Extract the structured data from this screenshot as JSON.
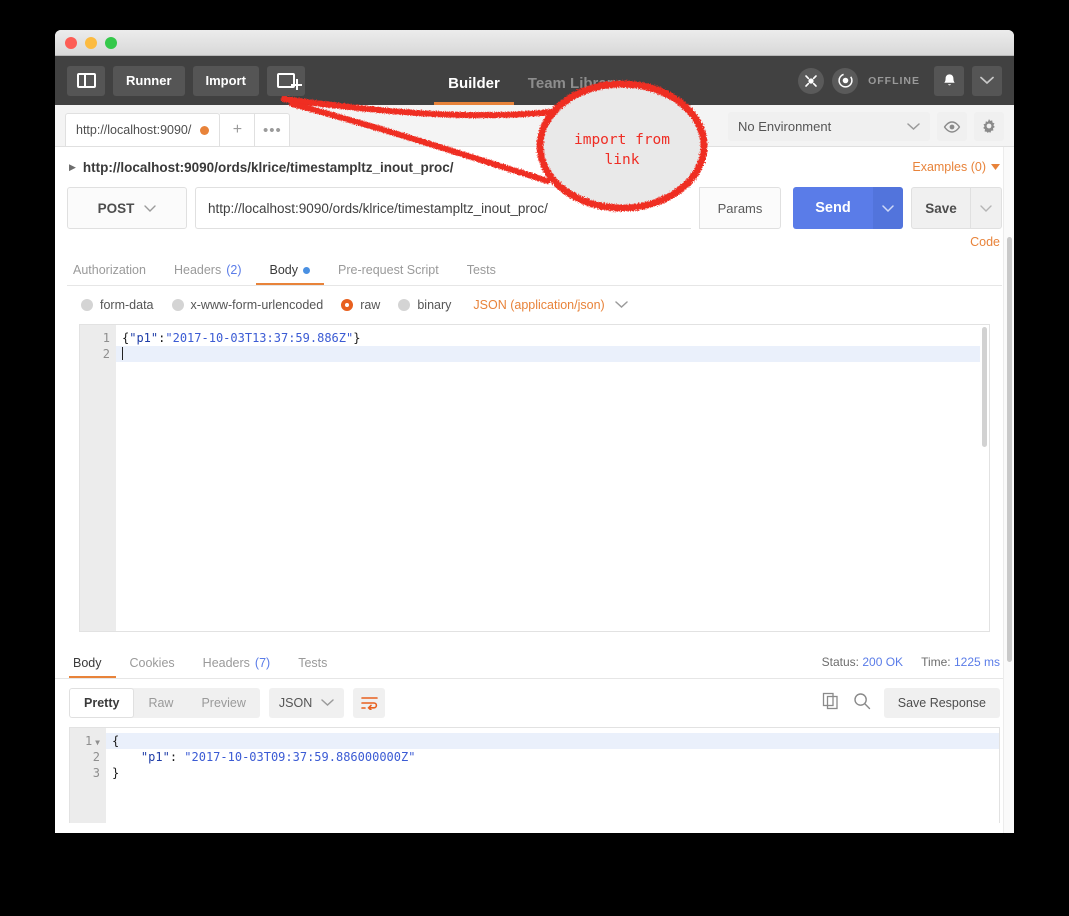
{
  "window": {
    "traffic_lights": [
      "close",
      "minimize",
      "zoom"
    ]
  },
  "toolbar": {
    "sidebar_toggle_icon": "sidebar-toggle-icon",
    "runner_label": "Runner",
    "import_label": "Import",
    "new_tab_icon": "new-tab-plus-icon",
    "tabs": [
      {
        "label": "Builder",
        "active": true
      },
      {
        "label": "Team Library",
        "active": false
      }
    ],
    "interceptor_icon": "interceptor-icon",
    "sync_icon": "sync-icon",
    "sync_status": "OFFLINE",
    "bell_icon": "bell-icon",
    "account_chevron_icon": "chevron-down-icon"
  },
  "tabstrip": {
    "request_tab_label": "http://localhost:9090/",
    "unsaved_indicator": "unsaved-dot",
    "new_tab_label": "+",
    "more_label": "•••",
    "environment_value": "No Environment",
    "eye_icon": "eye-icon",
    "gear_icon": "gear-icon"
  },
  "request": {
    "breadcrumb": "http://localhost:9090/ords/klrice/timestampltz_inout_proc/",
    "examples_label": "Examples (0)",
    "method": "POST",
    "url": "http://localhost:9090/ords/klrice/timestampltz_inout_proc/",
    "params_label": "Params",
    "send_label": "Send",
    "save_label": "Save",
    "code_label": "Code",
    "tabs": [
      {
        "label": "Authorization",
        "count": "",
        "active": false,
        "dot": false
      },
      {
        "label": "Headers",
        "count": "(2)",
        "active": false,
        "dot": false
      },
      {
        "label": "Body",
        "count": "",
        "active": true,
        "dot": true
      },
      {
        "label": "Pre-request Script",
        "count": "",
        "active": false,
        "dot": false
      },
      {
        "label": "Tests",
        "count": "",
        "active": false,
        "dot": false
      }
    ],
    "body_types": [
      {
        "label": "form-data",
        "selected": false
      },
      {
        "label": "x-www-form-urlencoded",
        "selected": false
      },
      {
        "label": "raw",
        "selected": true
      },
      {
        "label": "binary",
        "selected": false
      }
    ],
    "body_format": "JSON (application/json)",
    "body_lines": [
      "1",
      "2"
    ],
    "body_code": {
      "line1_open": "{",
      "line1_key": "\"p1\"",
      "line1_colon": ":",
      "line1_value": "\"2017-10-03T13:37:59.886Z\"",
      "line1_close": "}"
    }
  },
  "response": {
    "tabs": [
      {
        "label": "Body",
        "count": "",
        "active": true
      },
      {
        "label": "Cookies",
        "count": "",
        "active": false
      },
      {
        "label": "Headers",
        "count": "(7)",
        "active": false
      },
      {
        "label": "Tests",
        "count": "",
        "active": false
      }
    ],
    "status_label": "Status:",
    "status_value": "200 OK",
    "time_label": "Time:",
    "time_value": "1225 ms",
    "view_modes": [
      {
        "label": "Pretty",
        "active": true
      },
      {
        "label": "Raw",
        "active": false
      },
      {
        "label": "Preview",
        "active": false
      }
    ],
    "format": "JSON",
    "wrap_icon": "word-wrap-icon",
    "copy_icon": "copy-icon",
    "search_icon": "search-icon",
    "save_response_label": "Save Response",
    "body_lines": [
      "1",
      "2",
      "3"
    ],
    "body_code": {
      "line1": "{",
      "line2_key": "\"p1\"",
      "line2_colon": ": ",
      "line2_value": "\"2017-10-03T09:37:59.886000000Z\"",
      "line3": "}"
    }
  },
  "annotation": {
    "text_line1": "import from",
    "text_line2": "link",
    "color": "#ef2d24"
  },
  "colors": {
    "accent_orange": "#e8833a",
    "send_blue": "#5a7ce8",
    "toolbar_dark": "#414141",
    "annotation_red": "#ef2d24"
  }
}
